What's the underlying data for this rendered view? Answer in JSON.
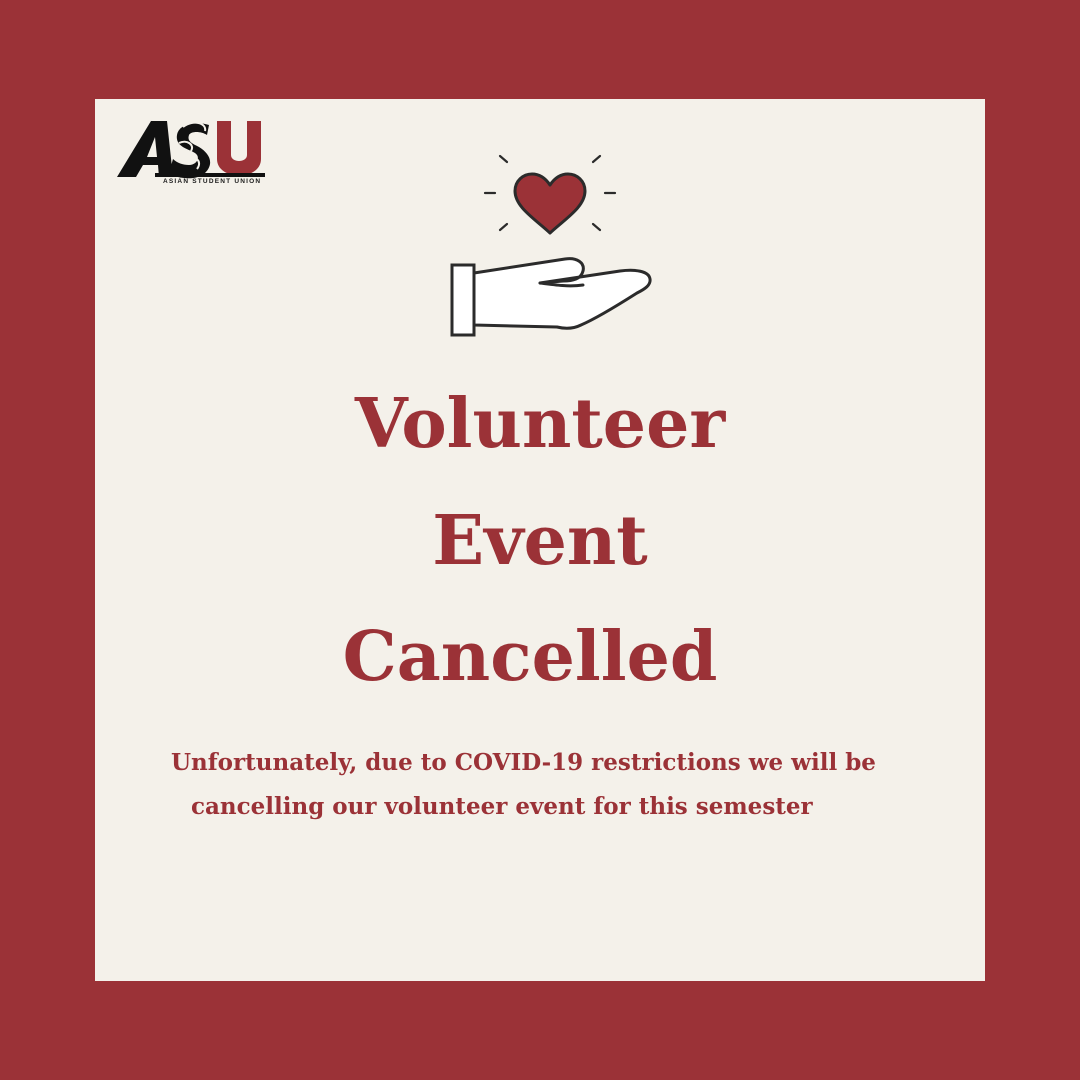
{
  "colors": {
    "border": "#9b3237",
    "card": "#f4f1ea",
    "accent": "#9b3237",
    "ink": "#2b2b2b",
    "logo_black": "#111111"
  },
  "logo": {
    "letters": "ASU",
    "caption": "ASIAN STUDENT UNION"
  },
  "illustration": {
    "icons": [
      "heart-icon",
      "open-hand-icon",
      "sparkle-rays"
    ]
  },
  "title": {
    "line1": "Volunteer",
    "line2": "Event",
    "line3": "Cancelled"
  },
  "message": {
    "line1": "Unfortunately, due to COVID-19 restrictions we will be",
    "line2": "cancelling our volunteer event for this semester"
  }
}
